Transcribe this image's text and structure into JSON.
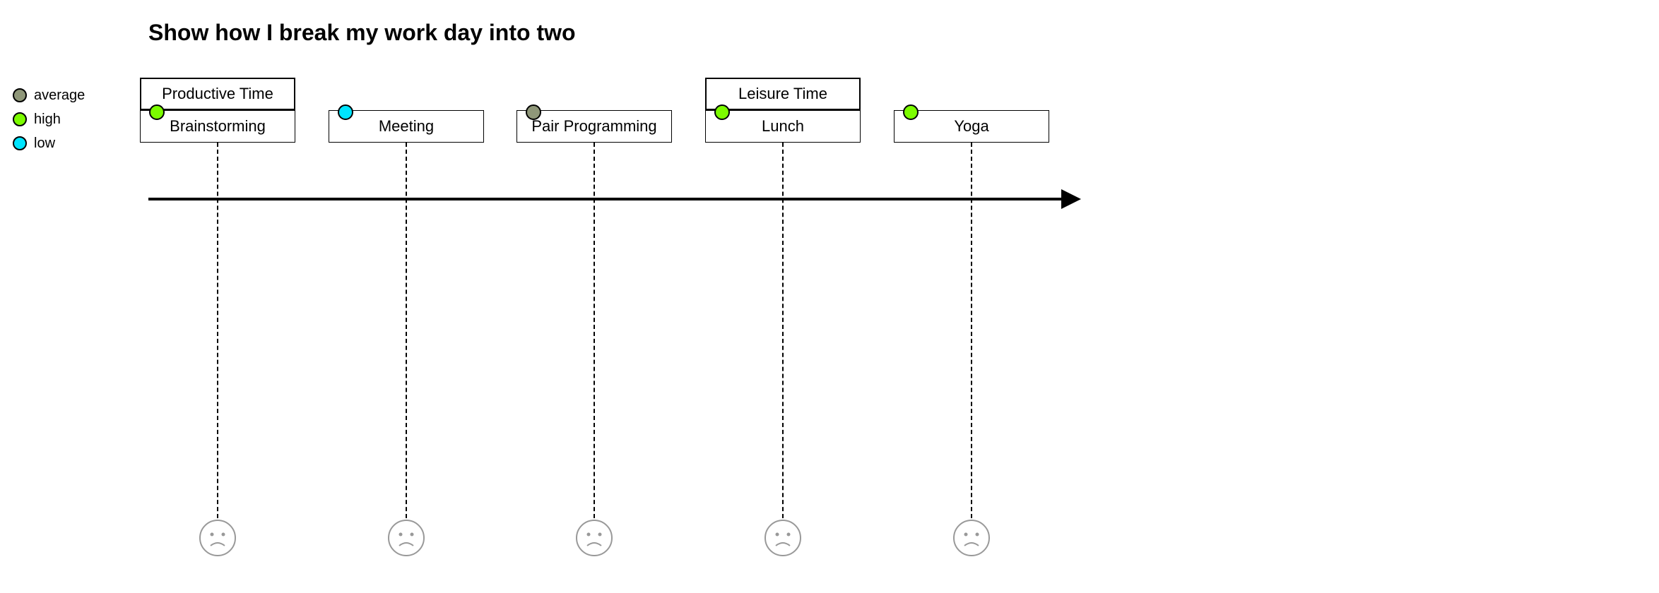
{
  "title": "Show how I break my work day into two",
  "legend": [
    {
      "label": "average",
      "color": "#8f9779"
    },
    {
      "label": "high",
      "color": "#7cfc00"
    },
    {
      "label": "low",
      "color": "#00e5ff"
    }
  ],
  "sections": [
    {
      "label": "Productive Time"
    },
    {
      "label": "Leisure Time"
    }
  ],
  "tasks": [
    {
      "label": "Brainstorming",
      "score": "high",
      "scoreColor": "#7cfc00"
    },
    {
      "label": "Meeting",
      "score": "low",
      "scoreColor": "#00e5ff"
    },
    {
      "label": "Pair Programming",
      "score": "average",
      "scoreColor": "#8f9779"
    },
    {
      "label": "Lunch",
      "score": "high",
      "scoreColor": "#7cfc00"
    },
    {
      "label": "Yoga",
      "score": "high",
      "scoreColor": "#7cfc00"
    }
  ],
  "chart_data": {
    "type": "timeline",
    "title": "Show how I break my work day into two",
    "legend": [
      "average",
      "high",
      "low"
    ],
    "sections": [
      {
        "name": "Productive Time",
        "tasks": [
          "Brainstorming",
          "Meeting",
          "Pair Programming"
        ]
      },
      {
        "name": "Leisure Time",
        "tasks": [
          "Lunch",
          "Yoga"
        ]
      }
    ],
    "events": [
      {
        "label": "Brainstorming",
        "score": "high"
      },
      {
        "label": "Meeting",
        "score": "low"
      },
      {
        "label": "Pair Programming",
        "score": "average"
      },
      {
        "label": "Lunch",
        "score": "high"
      },
      {
        "label": "Yoga",
        "score": "high"
      }
    ]
  }
}
